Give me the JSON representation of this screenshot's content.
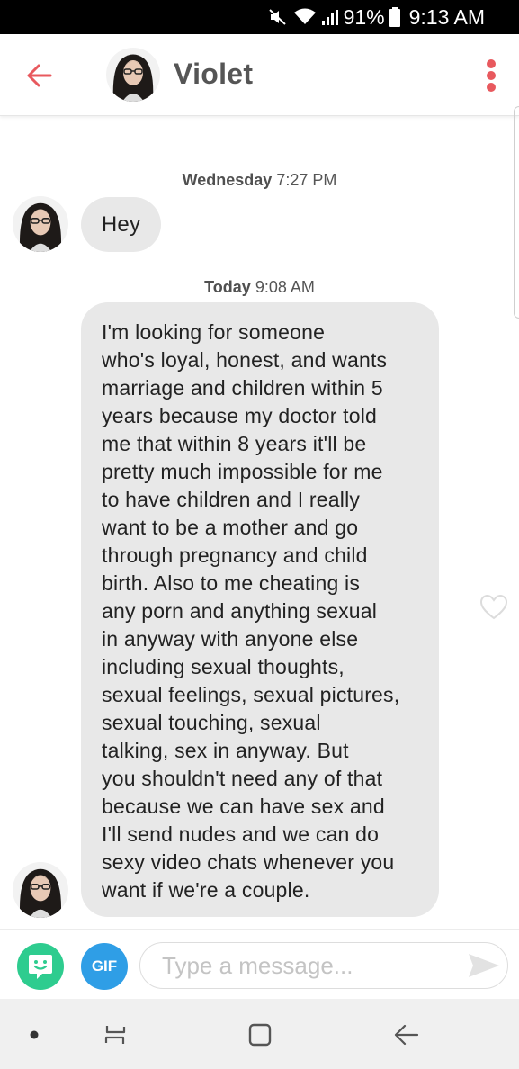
{
  "status_bar": {
    "battery_percent": "91%",
    "time": "9:13 AM",
    "icons": [
      "mute-icon",
      "wifi-icon",
      "signal-icon",
      "battery-icon"
    ]
  },
  "header": {
    "contact_name": "Violet",
    "icons": [
      "back-arrow-icon",
      "more-vert-icon"
    ],
    "accent_color": "#e8595e"
  },
  "messages": {
    "timestamps": [
      {
        "day": "Wednesday",
        "time": "7:27 PM"
      },
      {
        "day": "Today",
        "time": "9:08 AM"
      }
    ],
    "first": "Hey",
    "second": "I'm looking for someone\nwho's loyal, honest, and wants\nmarriage and children within 5\nyears because my doctor told\nme that within 8 years it'll be\npretty much impossible for me\nto have children and I really\nwant to be a mother and go\nthrough pregnancy and child\nbirth. Also to me cheating is\nany porn and anything sexual\nin anyway with anyone else\nincluding sexual thoughts,\nsexual feelings, sexual pictures,\nsexual touching, sexual\ntalking, sex in anyway. But\nyou shouldn't need any of that\nbecause we can have sex and\nI'll send nudes and we can do\nsexy video chats whenever you\nwant if we're a couple."
  },
  "composer": {
    "gif_label": "GIF",
    "placeholder": "Type a message...",
    "sticker_color": "#2ecc8f",
    "gif_color": "#2f9ee6"
  },
  "nav_bar": {
    "icons": [
      "dot-icon",
      "recents-icon",
      "home-icon",
      "back-icon"
    ]
  }
}
